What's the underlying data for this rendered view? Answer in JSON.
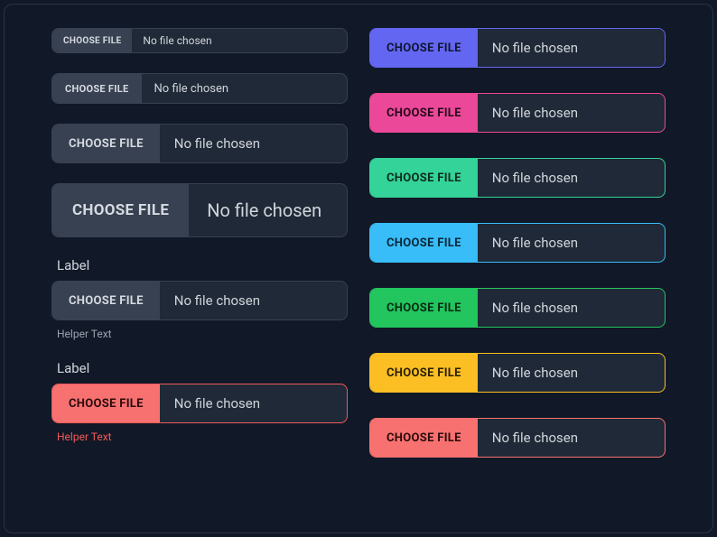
{
  "button_text": "Choose File",
  "status_text": "No file chosen",
  "label_text": "Label",
  "helper_text": "Helper Text",
  "left": {
    "sizes": [
      "xs",
      "sm",
      "md",
      "lg"
    ],
    "labeled": {
      "label": "Label",
      "helper": "Helper Text"
    },
    "danger": {
      "label": "Label",
      "helper": "Helper Text"
    }
  },
  "right": {
    "variants": [
      "indigo",
      "pink",
      "teal",
      "sky",
      "green",
      "amber",
      "red"
    ]
  }
}
